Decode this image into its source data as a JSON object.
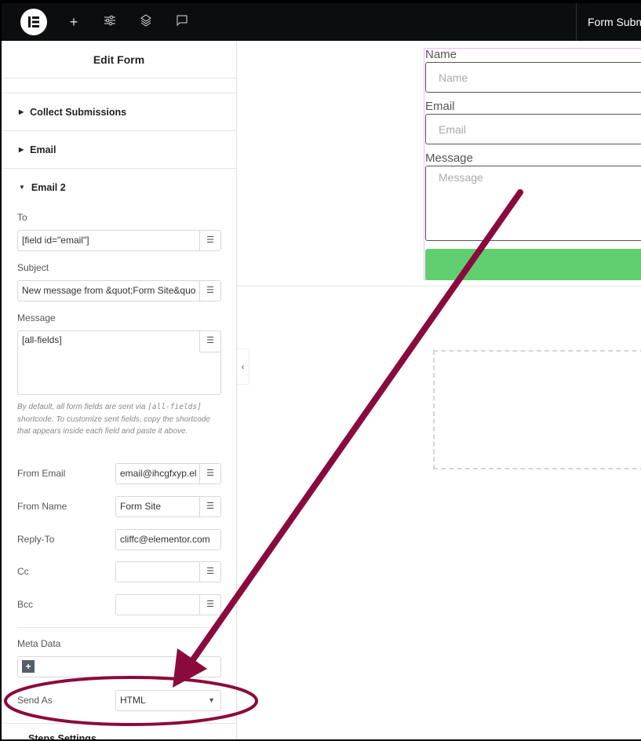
{
  "topbar": {
    "title": "Form Submi",
    "icons": [
      "elementor-logo",
      "plus-icon",
      "sliders-icon",
      "layers-icon",
      "comment-icon"
    ]
  },
  "panel": {
    "title": "Edit Form",
    "sections": [
      {
        "label": "Collect Submissions"
      },
      {
        "label": "Email"
      },
      {
        "label": "Email 2"
      }
    ],
    "to_label": "To",
    "to_value": "[field id=\"email\"]",
    "subject_label": "Subject",
    "subject_value": "New message from &quot;Form Site&quo",
    "message_label": "Message",
    "message_value": "[all-fields]",
    "note_1": "By default, all form fields are sent via ",
    "note_code": "[all-fields]",
    "note_2": " shortcode. To customize sent fields, copy the shortcode that appears inside each field and paste it above.",
    "from_email_label": "From Email",
    "from_email_value": "email@ihcgfxyp.el",
    "from_name_label": "From Name",
    "from_name_value": "Form Site",
    "reply_to_label": "Reply-To",
    "reply_to_value": "cliffc@elementor.com",
    "cc_label": "Cc",
    "bcc_label": "Bcc",
    "meta_label": "Meta Data",
    "send_as_label": "Send As",
    "send_as_value": "HTML",
    "next_section": "Steps Settings"
  },
  "preview": {
    "name_label": "Name",
    "name_placeholder": "Name",
    "email_label": "Email",
    "email_placeholder": "Email",
    "message_label": "Message",
    "message_placeholder": "Message"
  },
  "colors": {
    "accent": "#61ce70",
    "annotation": "#8b0a3e",
    "selection": "#f0b6f5"
  }
}
